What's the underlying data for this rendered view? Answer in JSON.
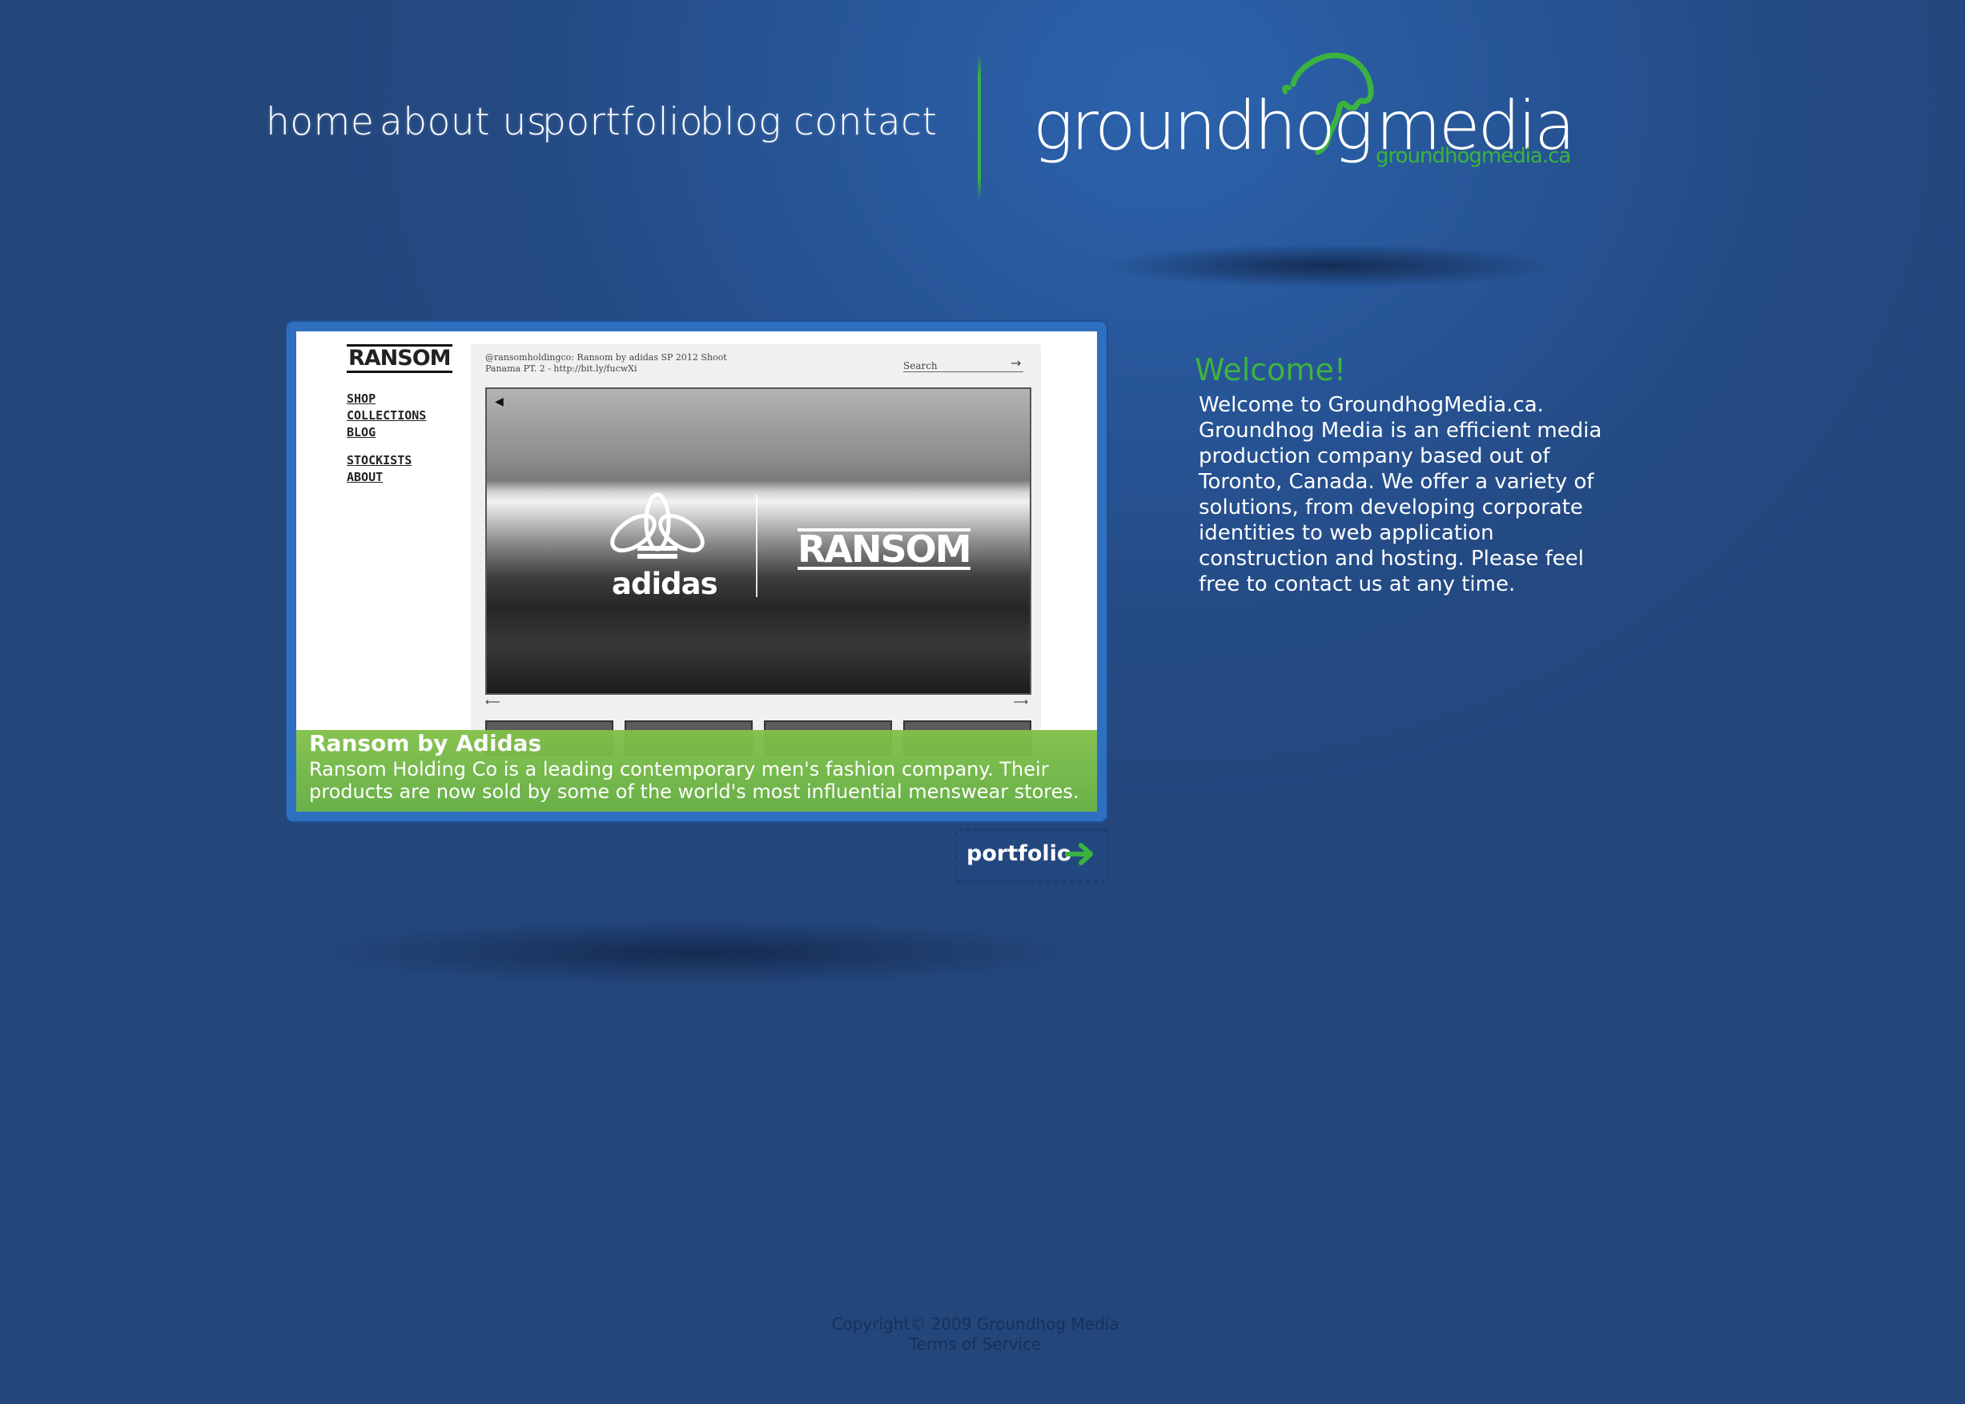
{
  "nav": {
    "items": [
      {
        "label": "home"
      },
      {
        "label": "about us"
      },
      {
        "label": "portfolio"
      },
      {
        "label": "blog"
      },
      {
        "label": "contact"
      }
    ]
  },
  "logo": {
    "word1": "groundhog",
    "word2": "media",
    "sub": "groundhogmedia.ca"
  },
  "slideshow": {
    "screenshot": {
      "brand": "RANSOM",
      "menu": [
        "SHOP",
        "COLLECTIONS",
        "BLOG",
        "STOCKISTS",
        "ABOUT"
      ],
      "tweet_line1": "@ransomholdingco: Ransom by adidas SP 2012 Shoot",
      "tweet_line2": "Panama PT. 2 - http://bit.ly/fucwXi",
      "search": "Search",
      "photo_brand_left": "adidas",
      "photo_brand_right": "RANSOM"
    },
    "caption_title": "Ransom by Adidas",
    "caption_text": "Ransom Holding Co is a leading contemporary men's fashion company. Their products are now sold by some of the world's most influential menswear stores."
  },
  "portfolio_button": {
    "label": "portfolio"
  },
  "welcome": {
    "title": "Welcome!",
    "text": "Welcome to GroundhogMedia.ca. Groundhog Media is an efficient media production company based out of Toronto, Canada. We offer a variety of solutions, from developing corporate identities to web application construction and hosting. Please feel free to contact us at any time."
  },
  "footer": {
    "copyright": "Copyright© 2009 Groundhog Media",
    "terms": "Terms of Service"
  },
  "colors": {
    "background": "#244a84",
    "accent_green": "#3bb33f",
    "caption_green": "#6db545"
  }
}
